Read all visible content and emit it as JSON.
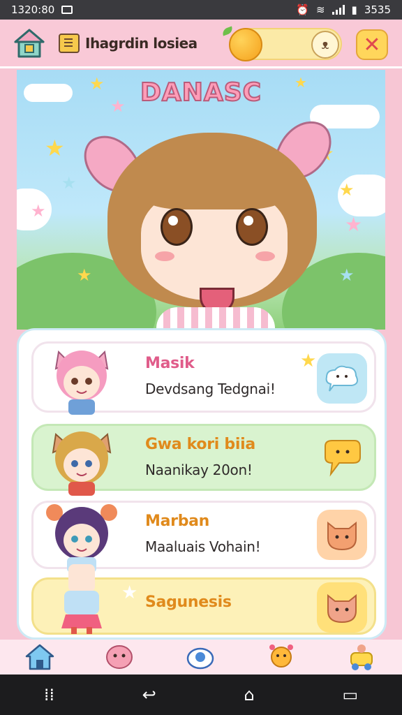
{
  "status_bar": {
    "time": "1320:80",
    "battery": "3535"
  },
  "header": {
    "title": "Ihagrdin losiea",
    "close_label": "✕"
  },
  "hero": {
    "title": "DANASC"
  },
  "list": [
    {
      "name": "Masik",
      "desc": "Devdsang Tedgnai!"
    },
    {
      "name": "Gwa kori biia",
      "desc": "Naanikay 20on!"
    },
    {
      "name": "Marban",
      "desc": "Maaluais Vohain!"
    },
    {
      "name": "Sagunesis",
      "desc": ""
    }
  ],
  "nav": [
    "home-icon",
    "pink-blob-icon",
    "camera-eye-icon",
    "sun-buddy-icon",
    "car-buddy-icon"
  ],
  "system_nav": {
    "recent": "⁞⁞",
    "back": "↩",
    "home": "⌂",
    "overview": "▭"
  },
  "colors": {
    "pink_bg": "#f7c6d4",
    "title_pink": "#e05c8a",
    "yellow": "#ffd65b",
    "sky": "#a7dcf5"
  }
}
